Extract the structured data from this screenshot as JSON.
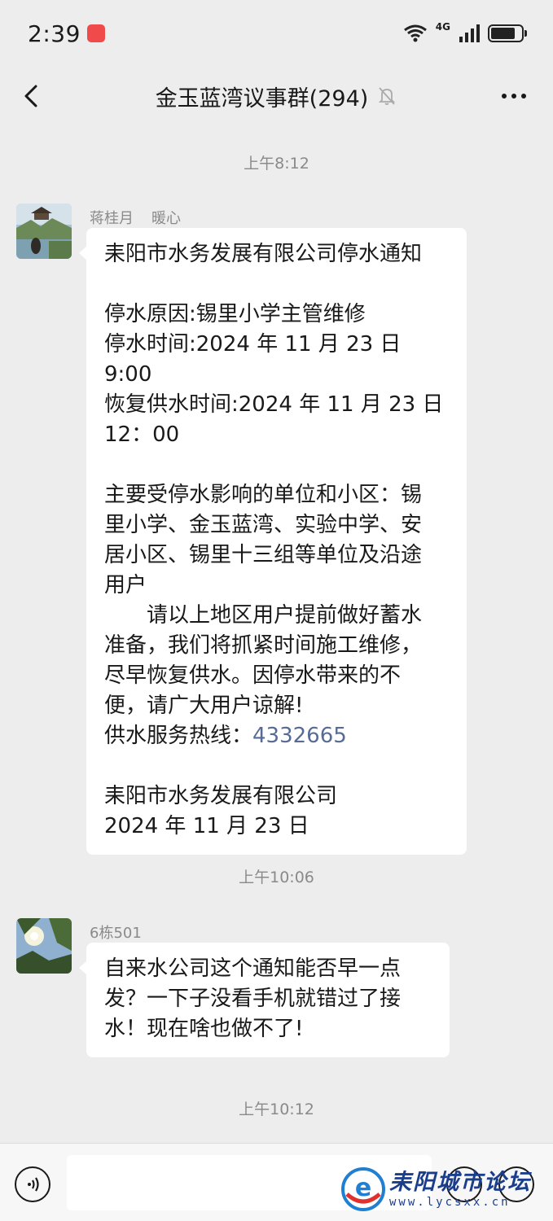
{
  "status_bar": {
    "time": "2:39",
    "network": "4G"
  },
  "header": {
    "title": "金玉蓝湾议事群(294)",
    "icons": [
      "back-arrow-icon",
      "mute-bell-icon",
      "more-icon"
    ]
  },
  "messages": [
    {
      "timestamp": "上午8:12",
      "sender_name": "蒋桂月",
      "sender_note": "暖心",
      "lines": [
        "耒阳市水务发展有限公司停水通知",
        "",
        "停水原因:锡里小学主管维修",
        "停水时间:2024 年 11 月 23 日 9:00",
        "恢复供水时间:2024 年 11 月 23 日",
        "12：00",
        "",
        "主要受停水影响的单位和小区：锡",
        "里小学、金玉蓝湾、实验中学、安",
        "居小区、锡里十三组等单位及沿途",
        "用户",
        "　　请以上地区用户提前做好蓄水",
        "准备，我们将抓紧时间施工维修，",
        "尽早恢复供水。因停水带来的不",
        "便，请广大用户谅解!"
      ],
      "hotline_label": "供水服务热线：",
      "hotline_number": "4332665",
      "signature_lines": [
        "耒阳市水务发展有限公司",
        "2024 年 11 月 23 日"
      ]
    },
    {
      "timestamp": "上午10:06",
      "sender_name": "6栋501",
      "lines": [
        "自来水公司这个通知能否早一点",
        "发？一下子没看手机就错过了接",
        "水！现在啥也做不了!"
      ]
    }
  ],
  "last_timestamp": "上午10:12",
  "watermark": {
    "title": "耒阳城市论坛",
    "url": "www.lycsxx.cn"
  },
  "colors": {
    "background": "#ededed",
    "bubble": "#ffffff",
    "link": "#576b95",
    "timestamp": "#8a8a8a"
  }
}
